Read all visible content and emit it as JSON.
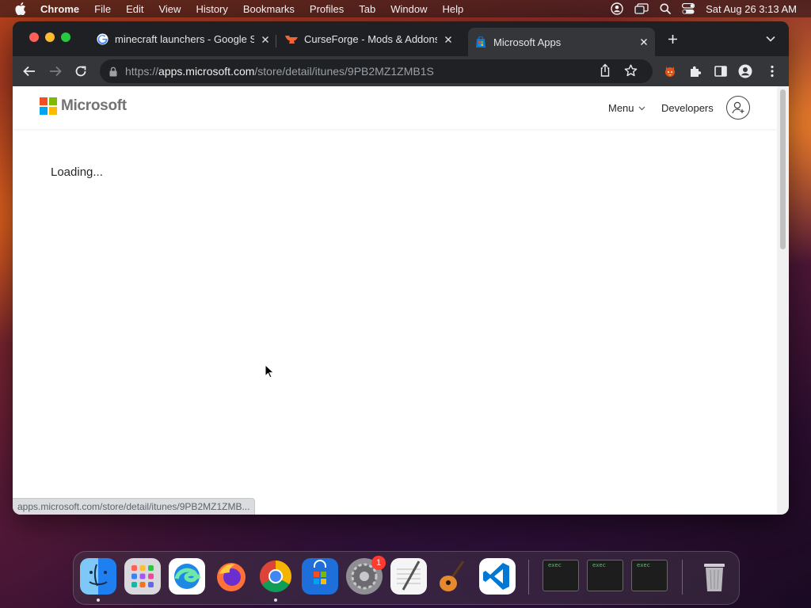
{
  "menubar": {
    "app_name": "Chrome",
    "items": [
      "File",
      "Edit",
      "View",
      "History",
      "Bookmarks",
      "Profiles",
      "Tab",
      "Window",
      "Help"
    ],
    "clock": "Sat Aug 26  3:13 AM"
  },
  "tabs": [
    {
      "title": "minecraft launchers - Google Search",
      "favicon": "google-icon"
    },
    {
      "title": "CurseForge - Mods & Addons Leader",
      "favicon": "curseforge-icon"
    },
    {
      "title": "Microsoft Apps",
      "favicon": "microsoft-store-icon",
      "active": true
    }
  ],
  "omnibox": {
    "scheme": "https://",
    "host": "apps.microsoft.com",
    "path": "/store/detail/itunes/9PB2MZ1ZMB1S"
  },
  "page": {
    "logo_text": "Microsoft",
    "nav_menu": "Menu",
    "nav_developers": "Developers",
    "loading_text": "Loading..."
  },
  "status_url": "apps.microsoft.com/store/detail/itunes/9PB2MZ1ZMB...",
  "dock": {
    "items": [
      "finder",
      "launchpad",
      "edge",
      "firefox",
      "chrome",
      "microsoft-store",
      "system-settings",
      "textedit",
      "garageband",
      "vscode",
      "terminal-1",
      "terminal-2",
      "terminal-3",
      "trash"
    ],
    "settings_badge": "1",
    "terminal_label": "exec"
  },
  "colors": {
    "ms_red": "#f25022",
    "ms_green": "#7fba00",
    "ms_blue": "#00a4ef",
    "ms_yellow": "#ffb900"
  }
}
